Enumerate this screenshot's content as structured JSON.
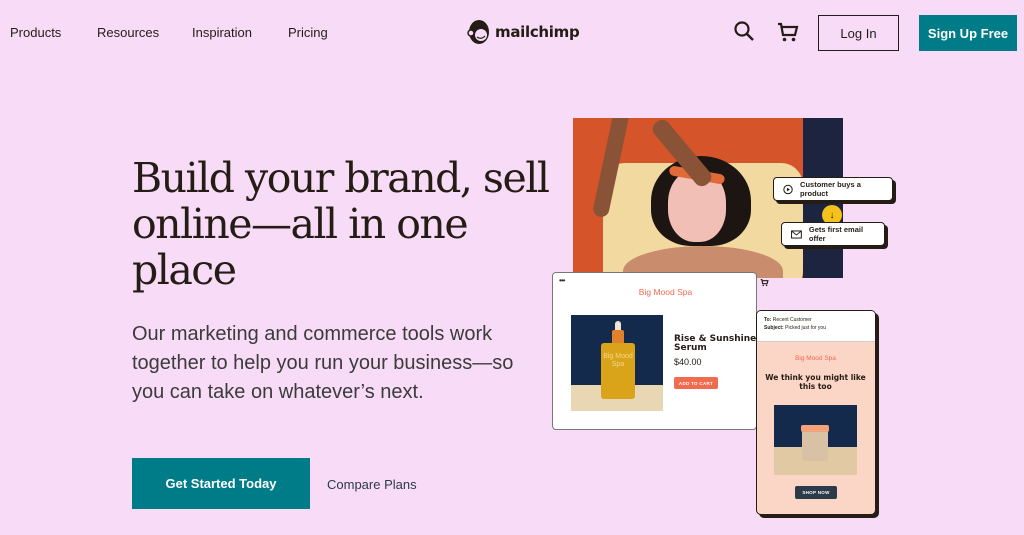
{
  "nav": {
    "links": [
      "Products",
      "Resources",
      "Inspiration",
      "Pricing"
    ],
    "logo_text": "mailchimp",
    "search_icon": "search-icon",
    "cart_icon": "cart-icon",
    "login_label": "Log In",
    "signup_label": "Sign Up Free"
  },
  "hero": {
    "headline": "Build your brand, sell online—all in one place",
    "subtext": "Our marketing and commerce tools work together to help you run your business—so you can take on whatever’s next.",
    "cta_label": "Get Started Today",
    "compare_label": "Compare Plans"
  },
  "illustration": {
    "flow_steps": [
      {
        "icon": "play-circle-icon",
        "label": "Customer buys a product"
      },
      {
        "icon": "envelope-icon",
        "label": "Gets first email offer"
      }
    ],
    "shop": {
      "menu_icon": "•••",
      "cart_glyph": "🛒",
      "store_name": "Big Mood Spa",
      "bottle_label": "Big Mood Spa",
      "product_name": "Rise & Sunshine Serum",
      "price": "$40.00",
      "add_to_cart_label": "ADD TO CART"
    },
    "email": {
      "to_label": "To:",
      "to_value": "Recent Customer",
      "subject_label": "Subject:",
      "subject_value": "Picked just for you",
      "brand": "Big Mood Spa",
      "headline": "We think you might like this too",
      "shop_now_label": "SHOP NOW"
    }
  },
  "colors": {
    "background": "#f8dcf7",
    "brand_teal": "#007c89",
    "text_dark": "#241c15",
    "accent_coral": "#f16b51"
  }
}
